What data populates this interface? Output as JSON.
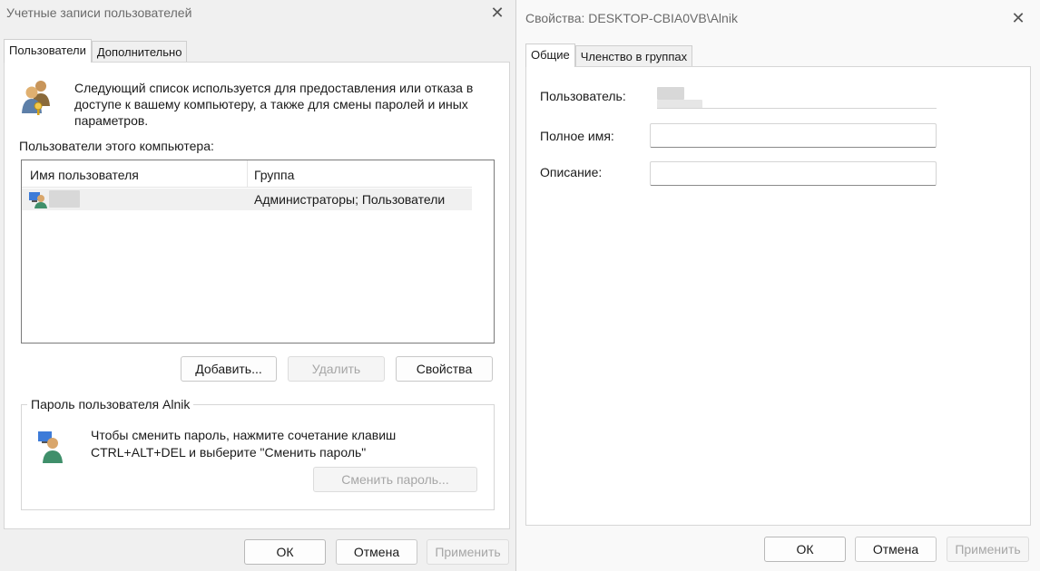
{
  "accounts_dialog": {
    "title": "Учетные записи пользователей",
    "tabs": [
      "Пользователи",
      "Дополнительно"
    ],
    "info_text": "Следующий список используется для предоставления или отказа в доступе к вашему компьютеру, а также для смены паролей и иных параметров.",
    "users_section_label": "Пользователи этого компьютера:",
    "columns": [
      "Имя пользователя",
      "Группа"
    ],
    "rows": [
      {
        "name": "",
        "group": "Администраторы; Пользователи"
      }
    ],
    "buttons": {
      "add": "Добавить...",
      "remove": "Удалить",
      "properties": "Свойства"
    },
    "password_group": {
      "title": "Пароль пользователя Alnik",
      "text_line1": "Чтобы сменить пароль, нажмите сочетание клавиш",
      "text_line2": "CTRL+ALT+DEL и выберите \"Сменить пароль\"",
      "change_button": "Сменить пароль..."
    },
    "footer": {
      "ok": "ОК",
      "cancel": "Отмена",
      "apply": "Применить"
    }
  },
  "properties_dialog": {
    "title": "Свойства: DESKTOP-CBIA0VB\\Alnik",
    "tabs": [
      "Общие",
      "Членство в группах"
    ],
    "fields": {
      "user_label": "Пользователь:",
      "user_value": "",
      "fullname_label": "Полное имя:",
      "fullname_value": "",
      "description_label": "Описание:",
      "description_value": ""
    },
    "footer": {
      "ok": "ОК",
      "cancel": "Отмена",
      "apply": "Применить"
    }
  }
}
